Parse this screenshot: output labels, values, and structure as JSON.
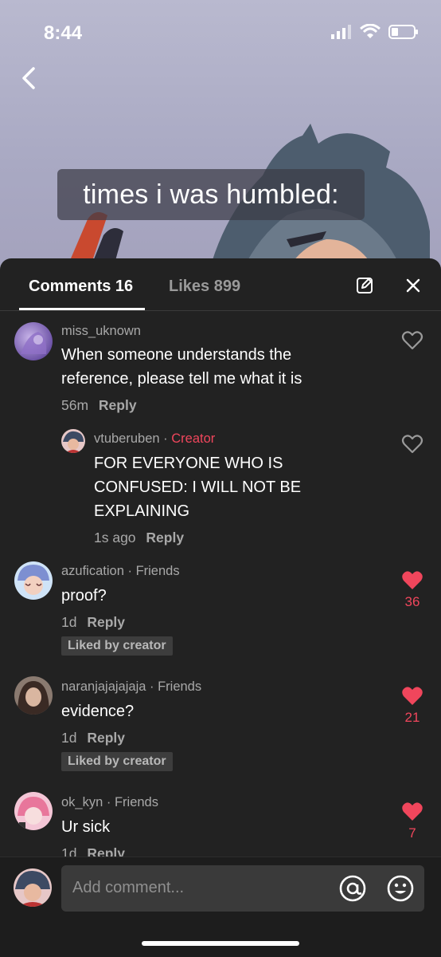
{
  "status_bar": {
    "time": "8:44"
  },
  "video": {
    "caption": "times i was humbled:"
  },
  "tabs": {
    "comments_label": "Comments 16",
    "likes_label": "Likes 899"
  },
  "comments": [
    {
      "username": "miss_uknown",
      "text_lines": [
        "When someone understands the",
        "reference, please tell me what it is"
      ],
      "time": "56m",
      "reply_label": "Reply"
    },
    {
      "username": "vtuberuben",
      "separator": " · ",
      "badge": "Creator",
      "text_lines": [
        "FOR EVERYONE WHO IS",
        "CONFUSED: I WILL NOT BE",
        "EXPLAINING"
      ],
      "time": "1s ago",
      "reply_label": "Reply"
    },
    {
      "username": "azufication",
      "separator": " · ",
      "badge": "Friends",
      "text_lines": [
        "proof?"
      ],
      "time": "1d",
      "reply_label": "Reply",
      "liked_tag": "Liked by creator",
      "likes": "36"
    },
    {
      "username": "naranjajajajaja",
      "separator": " · ",
      "badge": "Friends",
      "text_lines": [
        "evidence?"
      ],
      "time": "1d",
      "reply_label": "Reply",
      "liked_tag": "Liked by creator",
      "likes": "21"
    },
    {
      "username": "ok_kyn",
      "separator": " · ",
      "badge": "Friends",
      "text_lines": [
        "Ur sick"
      ],
      "time": "1d",
      "reply_label": "Reply",
      "likes": "7"
    }
  ],
  "input": {
    "placeholder": "Add comment..."
  },
  "colors": {
    "accent": "#f0465c",
    "sheet_bg": "#222222",
    "text_muted": "#a8a8a8"
  }
}
